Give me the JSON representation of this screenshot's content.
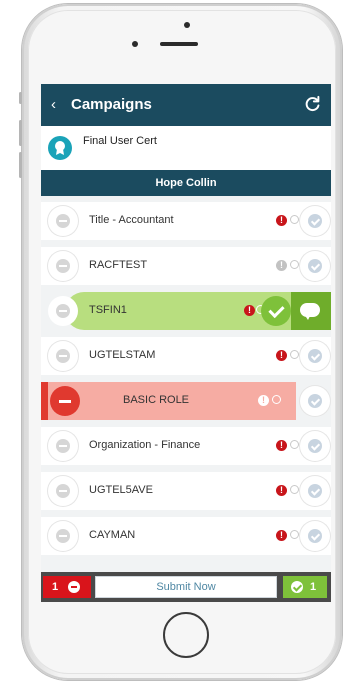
{
  "header": {
    "title": "Campaigns",
    "back_icon": "chevron-left-icon",
    "refresh_icon": "refresh-icon"
  },
  "campaign": {
    "name": "Final User Cert",
    "icon": "certificate-badge-icon"
  },
  "user": {
    "name": "Hope Collin"
  },
  "items": [
    {
      "label": "Title - Accountant",
      "alert": "!",
      "alert_color": "#c8151b",
      "state": "pending"
    },
    {
      "label": "RACFTEST",
      "alert": "!",
      "alert_color": "#c2c2c2",
      "state": "pending"
    },
    {
      "label": "TSFIN1",
      "alert": "!",
      "alert_color": "#c8151b",
      "state": "approved-swipe"
    },
    {
      "label": "UGTELSTAM",
      "alert": "!",
      "alert_color": "#c8151b",
      "state": "pending"
    },
    {
      "label": "BASIC ROLE",
      "alert": "!",
      "alert_color": "#ffffff",
      "state": "revoked-swipe"
    },
    {
      "label": "Organization - Finance",
      "alert": "!",
      "alert_color": "#c8151b",
      "state": "pending"
    },
    {
      "label": "UGTEL5AVE",
      "alert": "!",
      "alert_color": "#c8151b",
      "state": "pending"
    },
    {
      "label": "CAYMAN",
      "alert": "!",
      "alert_color": "#c8151b",
      "state": "pending"
    }
  ],
  "footer": {
    "revoked_count": "1",
    "submit_label": "Submit Now",
    "approved_count": "1"
  },
  "colors": {
    "header": "#1b4b5f",
    "approve": "#7ec13a",
    "revoke": "#d9141b",
    "approve_light": "#b8de7f",
    "revoke_light": "#f6aca3"
  }
}
